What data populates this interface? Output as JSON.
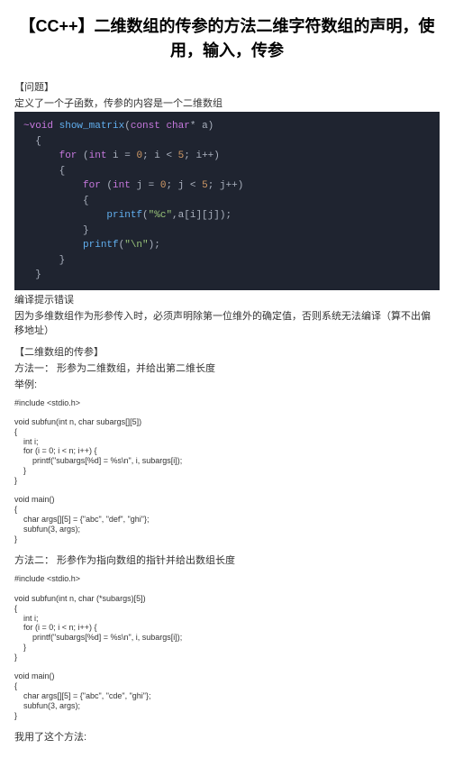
{
  "title": "【CC++】二维数组的传参的方法二维字符数组的声明，使用，输入，传参",
  "s1_hd": "【问题】",
  "s1_p1": "定义了一个子函数，传参的内容是一个二维数组",
  "code1": {
    "l1_a": "void",
    "l1_b": " show_matrix",
    "l1_c": "(",
    "l1_d": "const",
    "l1_e": " char",
    "l1_f": "* a)",
    "l3_a": "for",
    "l3_b": " (",
    "l3_c": "int",
    "l3_d": " i = ",
    "l3_e": "0",
    "l3_f": "; i < ",
    "l3_g": "5",
    "l3_h": "; i++)",
    "l5_a": "for",
    "l5_b": " (",
    "l5_c": "int",
    "l5_d": " j = ",
    "l5_e": "0",
    "l5_f": "; j < ",
    "l5_g": "5",
    "l5_h": "; j++)",
    "l7_a": "printf",
    "l7_b": "(",
    "l7_c": "\"%c\"",
    "l7_d": ",a[i][j]);",
    "l9_a": "printf",
    "l9_b": "(",
    "l9_c": "\"\\n\"",
    "l9_d": ");"
  },
  "s1_p2": "编译提示错误",
  "s1_p3": "因为多维数组作为形参传入时，必须声明除第一位维外的确定值，否则系统无法编译（算不出偏移地址）",
  "s2_hd": "【二维数组的传参】",
  "s2_p1": "方法一：  形参为二维数组，并给出第二维长度",
  "s2_p2": "举例:",
  "ex1": "#include <stdio.h>\n\nvoid subfun(int n, char subargs[][5])\n{\n    int i;\n    for (i = 0; i < n; i++) {\n        printf(\"subargs[%d] = %s\\n\", i, subargs[i]);\n    }\n}\n\nvoid main()\n{\n    char args[][5] = {\"abc\", \"def\", \"ghi\"};\n    subfun(3, args);\n}",
  "s2_p3": "方法二：  形参作为指向数组的指针并给出数组长度",
  "ex2": "#include <stdio.h>\n\nvoid subfun(int n, char (*subargs)[5])\n{\n    int i;\n    for (i = 0; i < n; i++) {\n        printf(\"subargs[%d] = %s\\n\", i, subargs[i]);\n    }\n}\n\nvoid main()\n{\n    char args[][5] = {\"abc\", \"cde\", \"ghi\"};\n    subfun(3, args);\n}",
  "s2_p4": "我用了这个方法:"
}
